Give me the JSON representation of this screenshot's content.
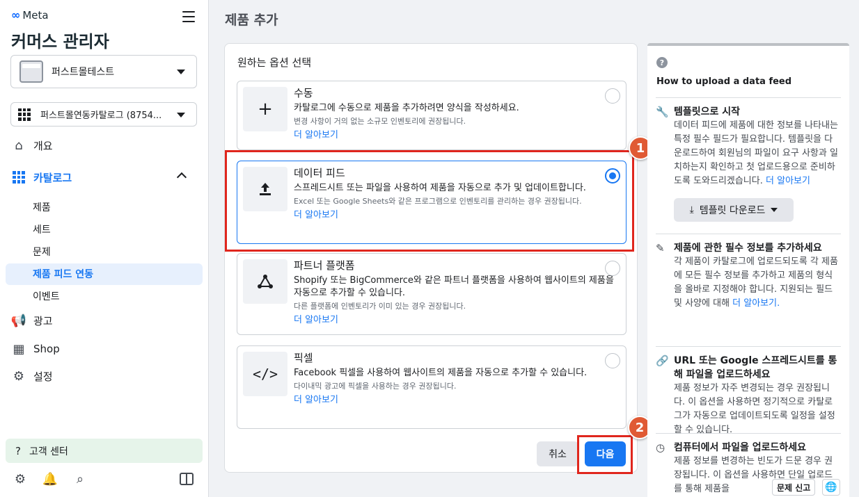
{
  "sidebar": {
    "brand": "Meta",
    "app_title": "커머스 관리자",
    "business": "퍼스트몰테스트",
    "catalog": "퍼스트몰연동카탈로그 (8754...",
    "nav": {
      "overview": "개요",
      "catalog": "카탈로그",
      "catalog_items": [
        "제품",
        "세트",
        "문제",
        "제품 피드 연동",
        "이벤트"
      ],
      "ads": "광고",
      "shop": "Shop",
      "settings": "설정"
    },
    "help_center": "고객 센터"
  },
  "main": {
    "page_title": "제품 추가",
    "card_title": "원하는 옵션 선택",
    "options": [
      {
        "title": "수동",
        "desc": "카탈로그에 수동으로 제품을 추가하려면 양식을 작성하세요.",
        "note": "변경 사항이 거의 없는 소규모 인벤토리에 권장됩니다.",
        "link": "더 알아보기",
        "icon": "plus-icon",
        "selected": false
      },
      {
        "title": "데이터 피드",
        "desc": "스프레드시트 또는 파일을 사용하여 제품을 자동으로 추가 및 업데이트합니다.",
        "note": "Excel 또는 Google Sheets와 같은 프로그램으로 인벤토리를 관리하는 경우 권장됩니다.",
        "link": "더 알아보기",
        "icon": "upload-icon",
        "selected": true
      },
      {
        "title": "파트너 플랫폼",
        "desc": "Shopify 또는 BigCommerce와 같은 파트너 플랫폼을 사용하여 웹사이트의 제품을 자동으로 추가할 수 있습니다.",
        "note": "다른 플랫폼에 인벤토리가 이미 있는 경우 권장됩니다.",
        "link": "더 알아보기",
        "icon": "partner-icon",
        "selected": false
      },
      {
        "title": "픽셀",
        "desc": "Facebook 픽셀을 사용하여 웹사이트의 제품을 자동으로 추가할 수 있습니다.",
        "note": "다이내믹 광고에 픽셀을 사용하는 경우 권장됩니다.",
        "link": "더 알아보기",
        "icon": "code-icon",
        "selected": false
      }
    ],
    "cancel_label": "취소",
    "next_label": "다음"
  },
  "annotations": [
    "1",
    "2"
  ],
  "help_panel": {
    "title": "How to upload a data feed",
    "sections": [
      {
        "heading": "템플릿으로 시작",
        "body": "데이터 피드에 제품에 대한 정보를 나타내는 특정 필수 필드가 필요합니다. 템플릿을 다운로드하여 회원님의 파일이 요구 사항과 일치하는지 확인하고 첫 업로드용으로 준비하도록 도와드리겠습니다.",
        "link": "더 알아보기"
      },
      {
        "heading": "제품에 관한 필수 정보를 추가하세요",
        "body": "각 제품이 카탈로그에 업로드되도록 각 제품에 모든 필수 정보를 추가하고 제품의 형식을 올바로 지정해야 합니다. 지원되는 필드 및 사양에 대해",
        "link": "더 알아보기."
      },
      {
        "heading": "URL 또는 Google 스프레드시트를 통해 파일을 업로드하세요",
        "body": "제품 정보가 자주 변경되는 경우 권장됩니다. 이 옵션을 사용하면 정기적으로 카탈로그가 자동으로 업데이트되도록 일정을 설정할 수 있습니다."
      },
      {
        "heading": "컴퓨터에서 파일을 업로드하세요",
        "body": "제품 정보를 변경하는 빈도가 드문 경우 권장됩니다. 이 옵션을 사용하면 단일 업로드를 통해 제품을"
      }
    ],
    "template_button": "템플릿 다운로드"
  },
  "footer": {
    "report_label": "문제 신고"
  }
}
